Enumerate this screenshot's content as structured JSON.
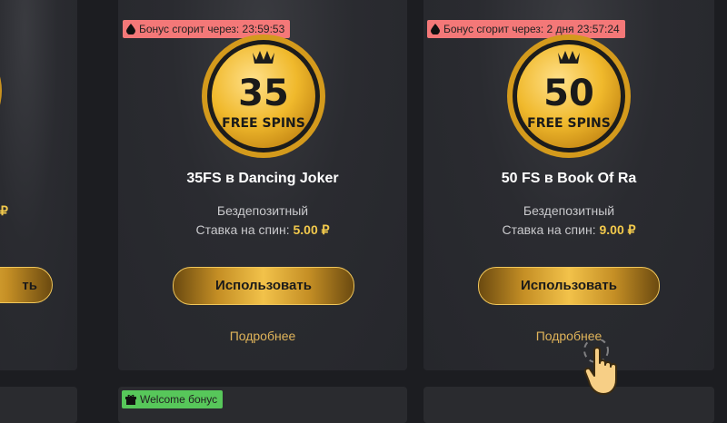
{
  "cards": [
    {
      "badge_icon": "drop-icon",
      "badge": "Бонус сгорит через: 23:59:53",
      "coin_number": "35",
      "coin_text": "FREE SPINS",
      "title": "35FS в Dancing Joker",
      "type": "Бездепозитный",
      "stake_label": "Ставка на спин:",
      "stake_value": "5.00 ₽",
      "button": "Использовать",
      "more": "Подробнее"
    },
    {
      "badge_icon": "drop-icon",
      "badge": "Бонус сгорит через: 2 дня 23:57:24",
      "coin_number": "50",
      "coin_text": "FREE SPINS",
      "title": "50 FS в Book Of Ra",
      "type": "Бездепозитный",
      "stake_label": "Ставка на спин:",
      "stake_value": "9.00 ₽",
      "button": "Использовать",
      "more": "Подробнее"
    }
  ],
  "partial_left_card": {
    "stake_currency": "₽",
    "button_tail": "ть"
  },
  "bottom_badge": {
    "icon": "gift-icon",
    "label": "Welcome бонус"
  },
  "colors": {
    "page_bg": "#1c1d21",
    "card_bg": "#2a2b30",
    "badge_red": "#f47878",
    "badge_green": "#57c75a",
    "gold": "#f2c94c"
  }
}
